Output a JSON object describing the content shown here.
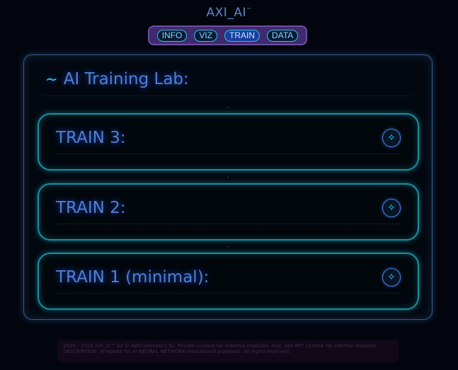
{
  "app": {
    "title": "AXI_AI",
    "trademark": "™"
  },
  "nav": {
    "items": [
      {
        "label": "INFO"
      },
      {
        "label": "VIZ"
      },
      {
        "label": "TRAIN",
        "active": true
      },
      {
        "label": "DATA"
      }
    ]
  },
  "lab": {
    "prefix": "~",
    "title": "AI Training Lab:",
    "cards": [
      {
        "title": "TRAIN 3:",
        "icon": "sparkle-icon"
      },
      {
        "title": "TRAIN 2:",
        "icon": "sparkle-icon"
      },
      {
        "title": "TRAIN 1 (minimal):",
        "icon": "sparkle-icon"
      }
    ]
  },
  "footer": {
    "line1": "2020 - 2024 AXI_AI™ by © NetCinematics llc. Private License for external modules. Also, see MIT License for internal modules.",
    "line2": "DESCRIPTION: Template for AI NEURAL NETWORK educational purposes. All rights reserved."
  },
  "colors": {
    "background": "#02050d",
    "accent_blue": "#4f80d1",
    "accent_cyan": "#1a8fa0",
    "nav_bar": "#3f2a6e"
  }
}
